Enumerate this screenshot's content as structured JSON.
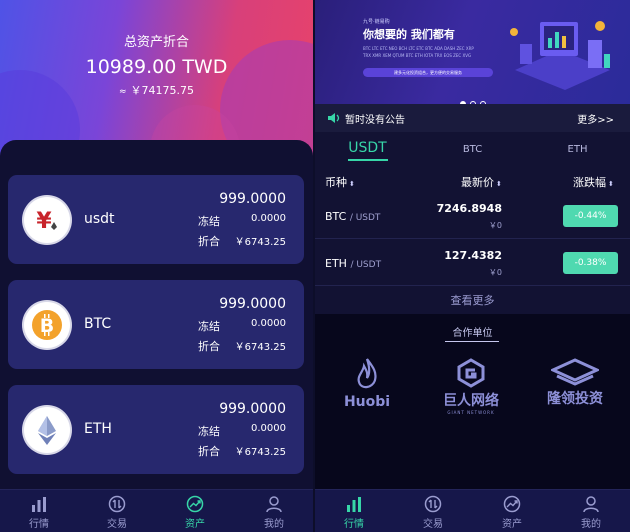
{
  "left": {
    "summary": {
      "title": "总资产折合",
      "amount": "10989.00 TWD",
      "approx_sign": "≈",
      "approx_value": "￥74175.75"
    },
    "assets": [
      {
        "name": "usdt",
        "icon": "yen-coin-icon",
        "amount": "999.0000",
        "frozen_label": "冻结",
        "frozen_value": "0.0000",
        "equiv_label": "折合",
        "equiv_value": "￥6743.25"
      },
      {
        "name": "BTC",
        "icon": "bitcoin-icon",
        "amount": "999.0000",
        "frozen_label": "冻结",
        "frozen_value": "0.0000",
        "equiv_label": "折合",
        "equiv_value": "￥6743.25"
      },
      {
        "name": "ETH",
        "icon": "ethereum-icon",
        "amount": "999.0000",
        "frozen_label": "冻结",
        "frozen_value": "0.0000",
        "equiv_label": "折合",
        "equiv_value": "￥6743.25"
      }
    ],
    "tabbar": [
      {
        "label": "行情",
        "icon": "bar-chart-icon",
        "active": false
      },
      {
        "label": "交易",
        "icon": "exchange-icon",
        "active": false
      },
      {
        "label": "资产",
        "icon": "trend-icon",
        "active": true
      },
      {
        "label": "我的",
        "icon": "user-icon",
        "active": false
      }
    ]
  },
  "right": {
    "banner": {
      "brand": "九号·链易购",
      "headline": "你想要的  我们都有",
      "coins": "BTC  LTC  ETC  NEO  BCH  LTC  ETC  BTC  ADA  DASH  ZEC  XRP  TRX  XMR  XEM  QTUM  BTC  ETH  IOTA  TRX  EOS  ZEC  XVG",
      "pill": "建多元化投资组合，更方便的交易服务",
      "dots": [
        true,
        false,
        false
      ]
    },
    "notice": {
      "text": "暂时没有公告",
      "more": "更多>>"
    },
    "market_tabs": [
      {
        "label": "USDT",
        "active": true
      },
      {
        "label": "BTC",
        "active": false
      },
      {
        "label": "ETH",
        "active": false
      }
    ],
    "table_headers": {
      "coin": "币种",
      "price": "最新价",
      "change": "涨跌幅",
      "sort_arrow": "⬍"
    },
    "rows": [
      {
        "base": "BTC",
        "quote": "/ USDT",
        "price": "7246.8948",
        "sub_price": "￥0",
        "change": "-0.44%"
      },
      {
        "base": "ETH",
        "quote": "/ USDT",
        "price": "127.4382",
        "sub_price": "￥0",
        "change": "-0.38%"
      }
    ],
    "view_more": "查看更多",
    "partners": {
      "title": "合作单位",
      "items": [
        {
          "name": "Huobi",
          "sub": "",
          "icon": "huobi-flame-icon"
        },
        {
          "name": "巨人网络",
          "sub": "GIANT NETWORK",
          "icon": "giant-network-icon"
        },
        {
          "name": "隆领投资",
          "sub": "",
          "icon": "longling-layers-icon"
        }
      ]
    },
    "tabbar": [
      {
        "label": "行情",
        "icon": "bar-chart-icon",
        "active": true
      },
      {
        "label": "交易",
        "icon": "exchange-icon",
        "active": false
      },
      {
        "label": "资产",
        "icon": "trend-icon",
        "active": false
      },
      {
        "label": "我的",
        "icon": "user-icon",
        "active": false
      }
    ]
  },
  "colors": {
    "accent": "#37d6a8",
    "card": "#27286e",
    "background": "#0f1033",
    "change_badge": "#4fd9b0"
  }
}
